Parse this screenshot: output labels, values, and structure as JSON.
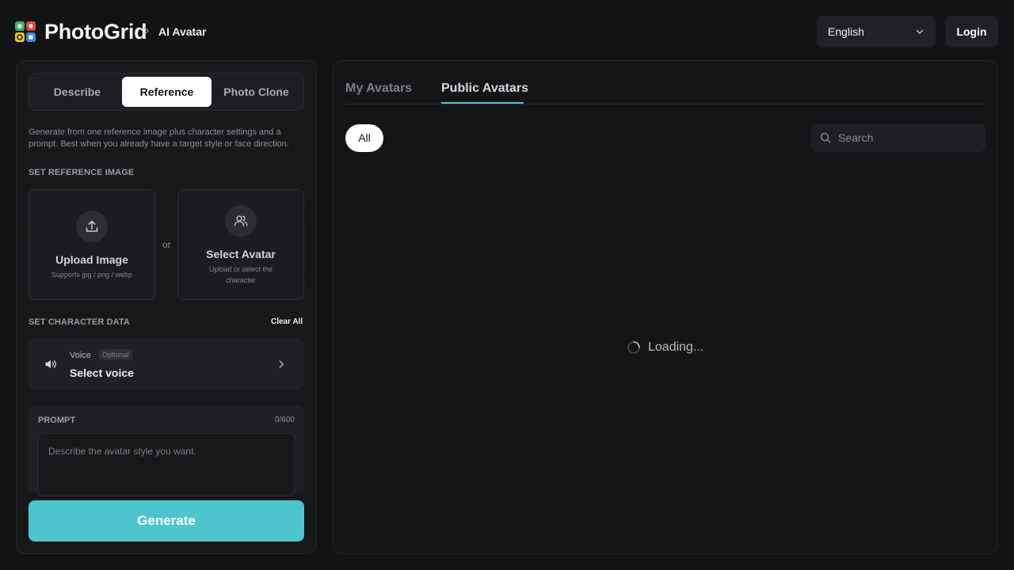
{
  "header": {
    "brand": "PhotoGrid",
    "breadcrumb": "AI Avatar",
    "language": "English",
    "login_label": "Login"
  },
  "left_panel": {
    "mode_tabs": [
      "Describe",
      "Reference",
      "Photo Clone"
    ],
    "active_mode": "Reference",
    "description": "Generate from one reference image plus character settings and a prompt. Best when you already have a target style or face direction.",
    "reference_section_label": "SET REFERENCE IMAGE",
    "upload": {
      "title": "Upload Image",
      "subtitle": "Supports jpg / png / webp"
    },
    "or_label": "or",
    "select_avatar": {
      "title": "Select Avatar",
      "subtitle": "Upload or select the character"
    },
    "character_section_label": "SET CHARACTER DATA",
    "clear_all_label": "Clear All",
    "voice": {
      "label": "Voice",
      "badge": "Optional",
      "value": "Select voice"
    },
    "prompt": {
      "label": "PROMPT",
      "counter": "0/600",
      "placeholder": "Describe the avatar style you want."
    },
    "generate_label": "Generate"
  },
  "right_panel": {
    "tabs": [
      "My Avatars",
      "Public Avatars"
    ],
    "active_tab": "Public Avatars",
    "filter_chip": "All",
    "search_placeholder": "Search",
    "loading_text": "Loading..."
  },
  "colors": {
    "accent": "#4ec4cd",
    "background": "#121315",
    "panel": "#17181a"
  },
  "icons": [
    "photogrid-logo-icon",
    "chevron-right-icon",
    "chevron-down-icon",
    "upload-icon",
    "users-icon",
    "speaker-icon",
    "search-icon",
    "spinner-icon"
  ]
}
